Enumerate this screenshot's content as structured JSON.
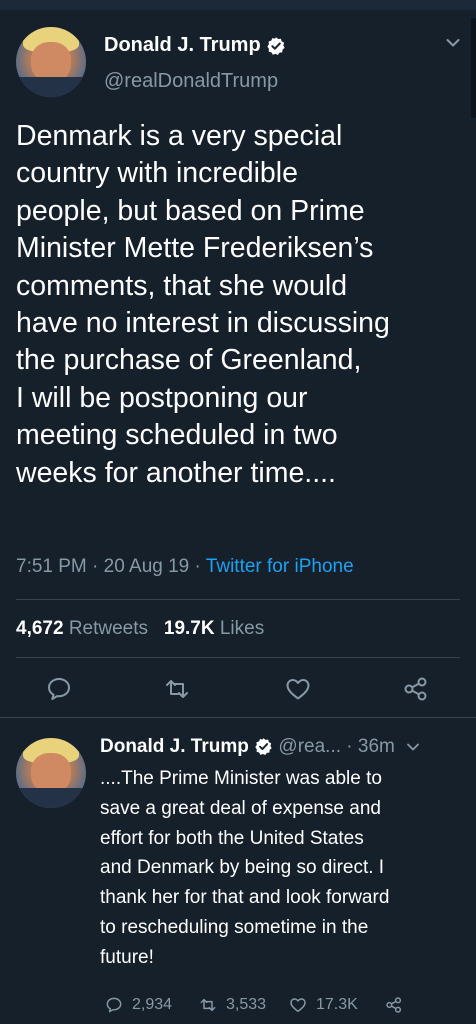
{
  "main_tweet": {
    "author_name": "Donald J. Trump",
    "handle": "@realDonaldTrump",
    "text_lines": [
      "Denmark is a very special",
      "country with incredible",
      "people, but based on Prime",
      "Minister Mette Frederiksen’s",
      "comments, that she would",
      "have no interest in discussing",
      "the purchase of Greenland,",
      "I will be postponing our",
      "meeting scheduled in two",
      "weeks for another time...."
    ],
    "time": "7:51 PM",
    "date": "20 Aug 19",
    "separator": "·",
    "source": "Twitter for iPhone",
    "retweets_count": "4,672",
    "retweets_label": "Retweets",
    "likes_count": "19.7K",
    "likes_label": "Likes"
  },
  "reply_tweet": {
    "author_name": "Donald J. Trump",
    "handle_truncated": "@rea...",
    "separator": "·",
    "age": "36m",
    "text_lines": [
      "....The Prime Minister was able to",
      "save a great deal of expense and",
      "effort for both the United States",
      "and Denmark by being so direct. I",
      "thank her for that and look forward",
      "to rescheduling sometime in the",
      "future!"
    ],
    "replies": "2,934",
    "retweets": "3,533",
    "likes": "17.3K"
  },
  "icons": {
    "verified": "verified-badge-icon",
    "reply": "reply-icon",
    "retweet": "retweet-icon",
    "like": "heart-icon",
    "share": "share-icon",
    "more": "chevron-down-icon"
  },
  "colors": {
    "background": "#15202b",
    "text": "#ffffff",
    "secondary": "#8899a6",
    "accent": "#1da1f2",
    "divider": "#38444d"
  }
}
